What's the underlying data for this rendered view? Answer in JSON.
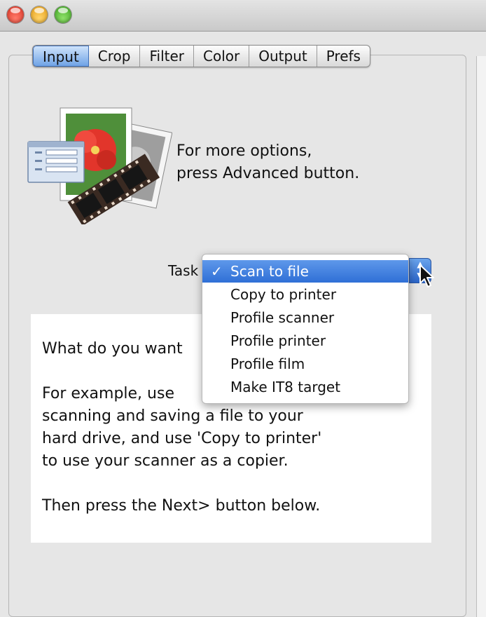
{
  "window": {
    "tabs": [
      "Input",
      "Crop",
      "Filter",
      "Color",
      "Output",
      "Prefs"
    ],
    "active_tab": "Input"
  },
  "info": {
    "line1": "For more options,",
    "line2": "press Advanced button."
  },
  "task": {
    "label": "Task",
    "selected": "Scan to file",
    "check": "✓",
    "options": [
      "Scan to file",
      "Copy to printer",
      "Profile scanner",
      "Profile printer",
      "Profile film",
      "Make IT8 target"
    ]
  },
  "description": {
    "line1": "What do you want",
    "line2": "For example, use",
    "line3": "scanning and saving a file to your",
    "line4": "hard drive, and use 'Copy to printer'",
    "line5": "to use your scanner as a copier.",
    "line6": "Then press the Next> button below."
  },
  "icons": {
    "close": "close-button-icon",
    "minimize": "minimize-button-icon",
    "zoom": "zoom-button-icon",
    "hero": "scanner-media-icon",
    "cursor": "mouse-pointer-icon"
  },
  "colors": {
    "accent": "#3f7fdc",
    "panel": "#e6e6e6",
    "selection": "#2f6fd6"
  }
}
